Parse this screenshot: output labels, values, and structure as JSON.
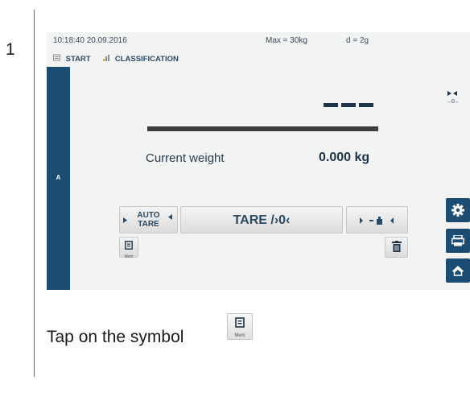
{
  "step": {
    "number": "1"
  },
  "screen": {
    "status": {
      "time_date": "10:18:40 20.09.2016",
      "max": "Max = 30kg",
      "d": "d = 2g"
    },
    "mode": {
      "start_label": "START",
      "classification_label": "CLASSIFICATION"
    },
    "sidebar_letter": "A",
    "weight": {
      "label": "Current weight",
      "value": "0.000 kg"
    },
    "zero_indicator": "→0←",
    "buttons": {
      "auto_tare_line1": "AUTO",
      "auto_tare_line2": "TARE",
      "tare": "TARE /›0‹",
      "mem_label": "Mem"
    },
    "colors": {
      "sidebar": "#1c4c72",
      "background": "#f2f3f3",
      "button": "#e6e6e6"
    }
  },
  "instruction": {
    "text": "Tap on the symbol",
    "mem_label": "Mem"
  }
}
